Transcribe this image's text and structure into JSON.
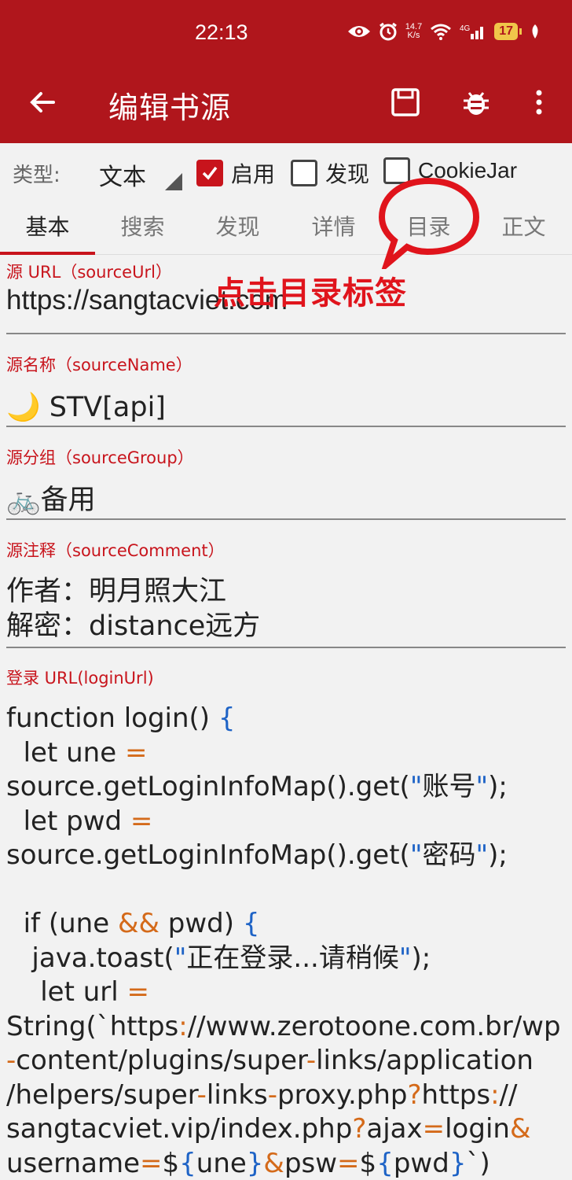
{
  "status_bar": {
    "time": "22:13",
    "net_speed_top": "14.7",
    "net_speed_bottom": "K/s",
    "signal_label": "4G",
    "battery": "17"
  },
  "toolbar": {
    "title": "编辑书源",
    "back_icon": "arrow-left-icon",
    "save_icon": "save-icon",
    "debug_icon": "bug-icon",
    "more_icon": "more-vert-icon"
  },
  "type_row": {
    "label": "类型:",
    "selected": "文本",
    "checkboxes": [
      {
        "label": "启用",
        "checked": true
      },
      {
        "label": "发现",
        "checked": false
      },
      {
        "label": "CookieJar",
        "checked": false
      }
    ]
  },
  "tabs": [
    "基本",
    "搜索",
    "发现",
    "详情",
    "目录",
    "正文"
  ],
  "active_tab": 0,
  "annotation": {
    "text": "点击目录标签",
    "color": "#e0141c"
  },
  "fields": [
    {
      "label": "源 URL（sourceUrl）",
      "value": "https://sangtacviet.com"
    },
    {
      "label": "源名称（sourceName）",
      "value": "🌙 STV[api]"
    },
    {
      "label": "源分组（sourceGroup）",
      "value": "🚲备用"
    },
    {
      "label": "源注释（sourceComment）",
      "value": "作者：明月照大江\n解密：distance远方"
    },
    {
      "label": "登录 URL(loginUrl)",
      "value": ""
    }
  ],
  "login_code": {
    "lines": [
      "function login() {",
      "  let une =",
      "source.getLoginInfoMap().get(\"账号\");",
      "  let pwd =",
      "source.getLoginInfoMap().get(\"密码\");",
      "",
      "  if (une && pwd) {",
      "   java.toast(\"正在登录...请稍候\");",
      "    let url =",
      "String(`https://www.zerotoone.com.br/wp",
      "-content/plugins/super-links/application",
      "/helpers/super-links-proxy.php?https://",
      "sangtacviet.vip/index.php?ajax=login&",
      "username=${une}&psw=${pwd}`)"
    ]
  },
  "colors": {
    "primary": "#b0161c",
    "accent": "#c8141c",
    "operator": "#d46a1a",
    "bracket": "#1e63c6"
  }
}
